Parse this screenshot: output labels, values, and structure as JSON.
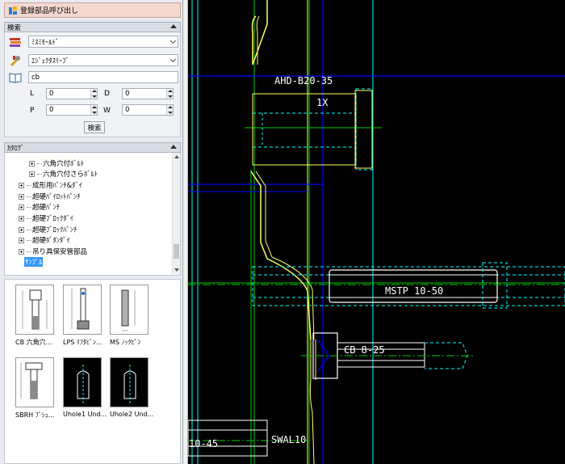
{
  "recall_button": {
    "label": "登録部品呼び出し"
  },
  "search_panel": {
    "header": "検索",
    "maker_select": "ﾐｽﾐﾓｰﾙﾄﾞ",
    "category_select": "ｴｼﾞｪｸﾀｽﾘｰﾌﾞ",
    "keyword": "cb",
    "params": [
      {
        "label": "L",
        "value": "0"
      },
      {
        "label": "D",
        "value": "0"
      },
      {
        "label": "P",
        "value": "0"
      },
      {
        "label": "W",
        "value": "0"
      }
    ],
    "search_button": "検索"
  },
  "catalog_panel": {
    "header": "ｶﾀﾛｸﾞ",
    "tree_items": [
      {
        "label": "六角穴付ﾎﾞﾙﾄ",
        "level": 2,
        "selected": false
      },
      {
        "label": "六角穴付さらﾎﾞﾙﾄ",
        "level": 2,
        "selected": false
      },
      {
        "label": "成形用ﾊﾟﾝﾁ&ﾀﾞｲ",
        "level": 1,
        "selected": false
      },
      {
        "label": "超硬ﾊﾟｲﾛｯﾄﾊﾟﾝﾁ",
        "level": 1,
        "selected": false
      },
      {
        "label": "超硬ﾊﾟﾝﾁ",
        "level": 1,
        "selected": false
      },
      {
        "label": "超硬ﾌﾞﾛｯｸﾀﾞｲ",
        "level": 1,
        "selected": false
      },
      {
        "label": "超硬ﾌﾞﾛｯｸﾊﾟﾝﾁ",
        "level": 1,
        "selected": false
      },
      {
        "label": "超硬ﾎﾞﾀﾝﾀﾞｲ",
        "level": 1,
        "selected": false
      },
      {
        "label": "吊り具保安管部品",
        "level": 1,
        "selected": false
      },
      {
        "label": "ｻﾝﾌﾟﾙ",
        "level": 0,
        "selected": true
      }
    ]
  },
  "thumbnails": [
    {
      "caption": "CB 六角穴..."
    },
    {
      "caption": "LPS ﾘﾌﾀﾋﾟﾝ..."
    },
    {
      "caption": "MS ﾉｯｸﾋﾟﾝ"
    },
    {
      "caption": "SBRH ﾌﾟｼｭ..."
    },
    {
      "caption": "Uhole1 Und..."
    },
    {
      "caption": "Uhole2 Und..."
    }
  ],
  "cad": {
    "labels": {
      "ahd": "AHD-B20-35",
      "qty": "1X",
      "mstp": "MSTP 10-50",
      "cb": "CB 8-25",
      "swal": "SWAL10",
      "edge": "10-45"
    },
    "colors": {
      "background": "#000000",
      "yellow": "#ffff66",
      "cyan": "#00ffff",
      "blue": "#0000ff",
      "green": "#00cc00",
      "white": "#ffffff"
    }
  }
}
